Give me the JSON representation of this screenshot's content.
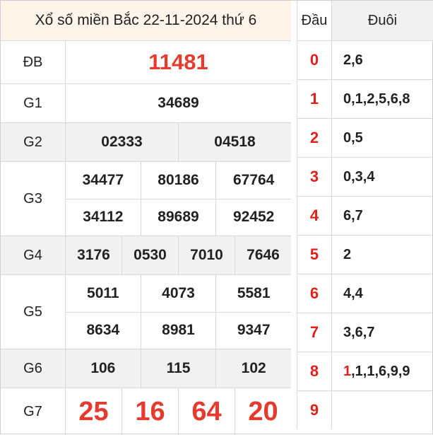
{
  "title": "Xổ số miền Bắc 22-11-2024 thứ 6",
  "prizes": {
    "db": {
      "label": "ĐB",
      "numbers": [
        "11481"
      ]
    },
    "g1": {
      "label": "G1",
      "numbers": [
        "34689"
      ]
    },
    "g2": {
      "label": "G2",
      "numbers": [
        "02333",
        "04518"
      ]
    },
    "g3": {
      "label": "G3",
      "numbers": [
        "34477",
        "80186",
        "67764",
        "34112",
        "89689",
        "92452"
      ]
    },
    "g4": {
      "label": "G4",
      "numbers": [
        "3176",
        "0530",
        "7010",
        "7646"
      ]
    },
    "g5": {
      "label": "G5",
      "numbers": [
        "5011",
        "4073",
        "5581",
        "8634",
        "8981",
        "9347"
      ]
    },
    "g6": {
      "label": "G6",
      "numbers": [
        "106",
        "115",
        "102"
      ]
    },
    "g7": {
      "label": "G7",
      "numbers": [
        "25",
        "16",
        "64",
        "20"
      ]
    }
  },
  "loto": {
    "head_label": "Đầu",
    "tail_label": "Đuôi",
    "rows": [
      {
        "head": "0",
        "tail": "2,6"
      },
      {
        "head": "1",
        "tail": "0,1,2,5,6,8"
      },
      {
        "head": "2",
        "tail": "0,5"
      },
      {
        "head": "3",
        "tail": "0,3,4"
      },
      {
        "head": "4",
        "tail": "6,7"
      },
      {
        "head": "5",
        "tail": "2"
      },
      {
        "head": "6",
        "tail": "4,4"
      },
      {
        "head": "7",
        "tail": "3,6,7"
      },
      {
        "head": "8",
        "tail_highlight": "1",
        "tail_rest": ",1,1,6,9,9"
      },
      {
        "head": "9",
        "tail": ""
      }
    ]
  },
  "colors": {
    "accent_red": "#e53b2f",
    "title_bg": "#fff4ea",
    "row_gray": "#f1f1f1"
  }
}
